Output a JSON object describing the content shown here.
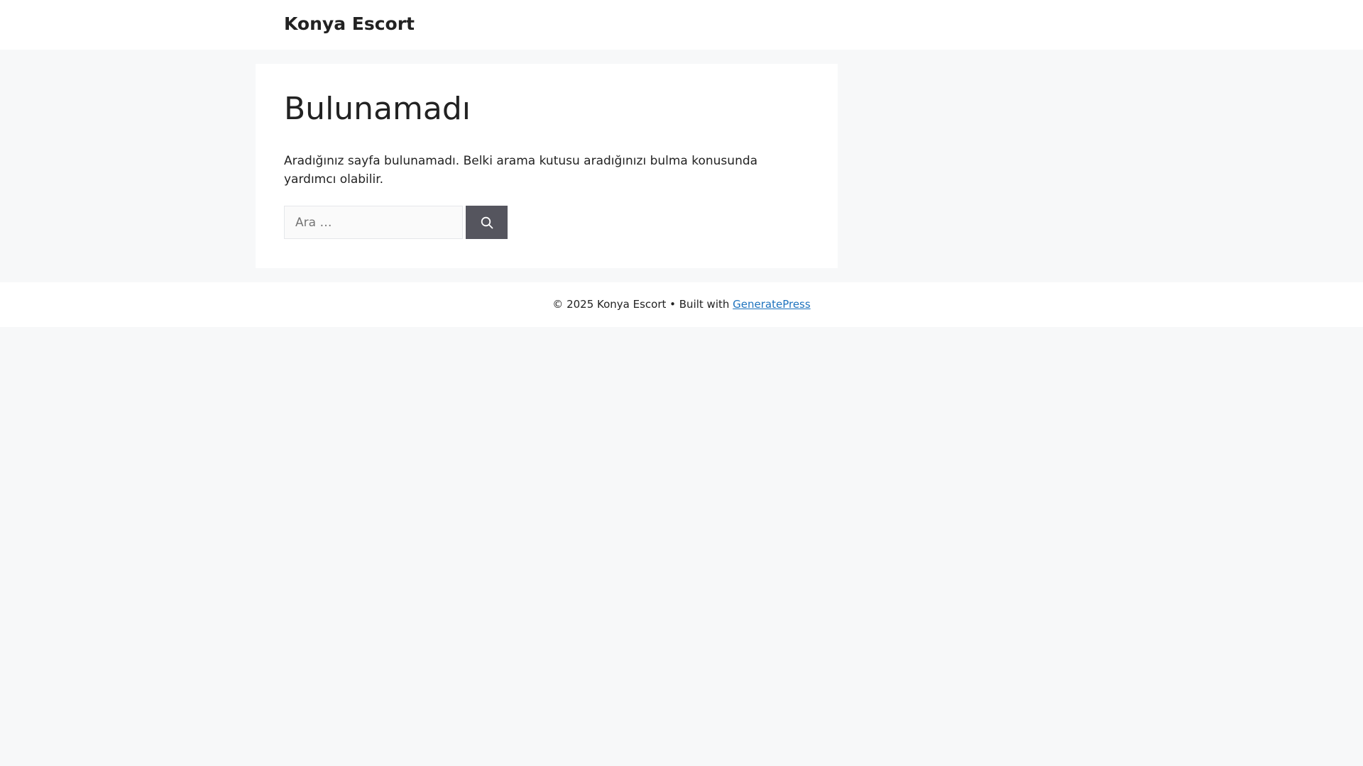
{
  "header": {
    "site_title": "Konya Escort"
  },
  "main": {
    "title": "Bulunamadı",
    "message": "Aradığınız sayfa bulunamadı. Belki arama kutusu aradığınızı bulma konusunda yardımcı olabilir.",
    "search": {
      "placeholder": "Ara …",
      "value": "",
      "button_icon": "search-icon"
    }
  },
  "footer": {
    "copyright": "© 2025 Konya Escort • Built with",
    "link_label": "GeneratePress"
  },
  "colors": {
    "page_background": "#f7f8f9",
    "surface": "#ffffff",
    "text": "#222222",
    "search_button": "#55555e",
    "link": "#1e73be"
  }
}
